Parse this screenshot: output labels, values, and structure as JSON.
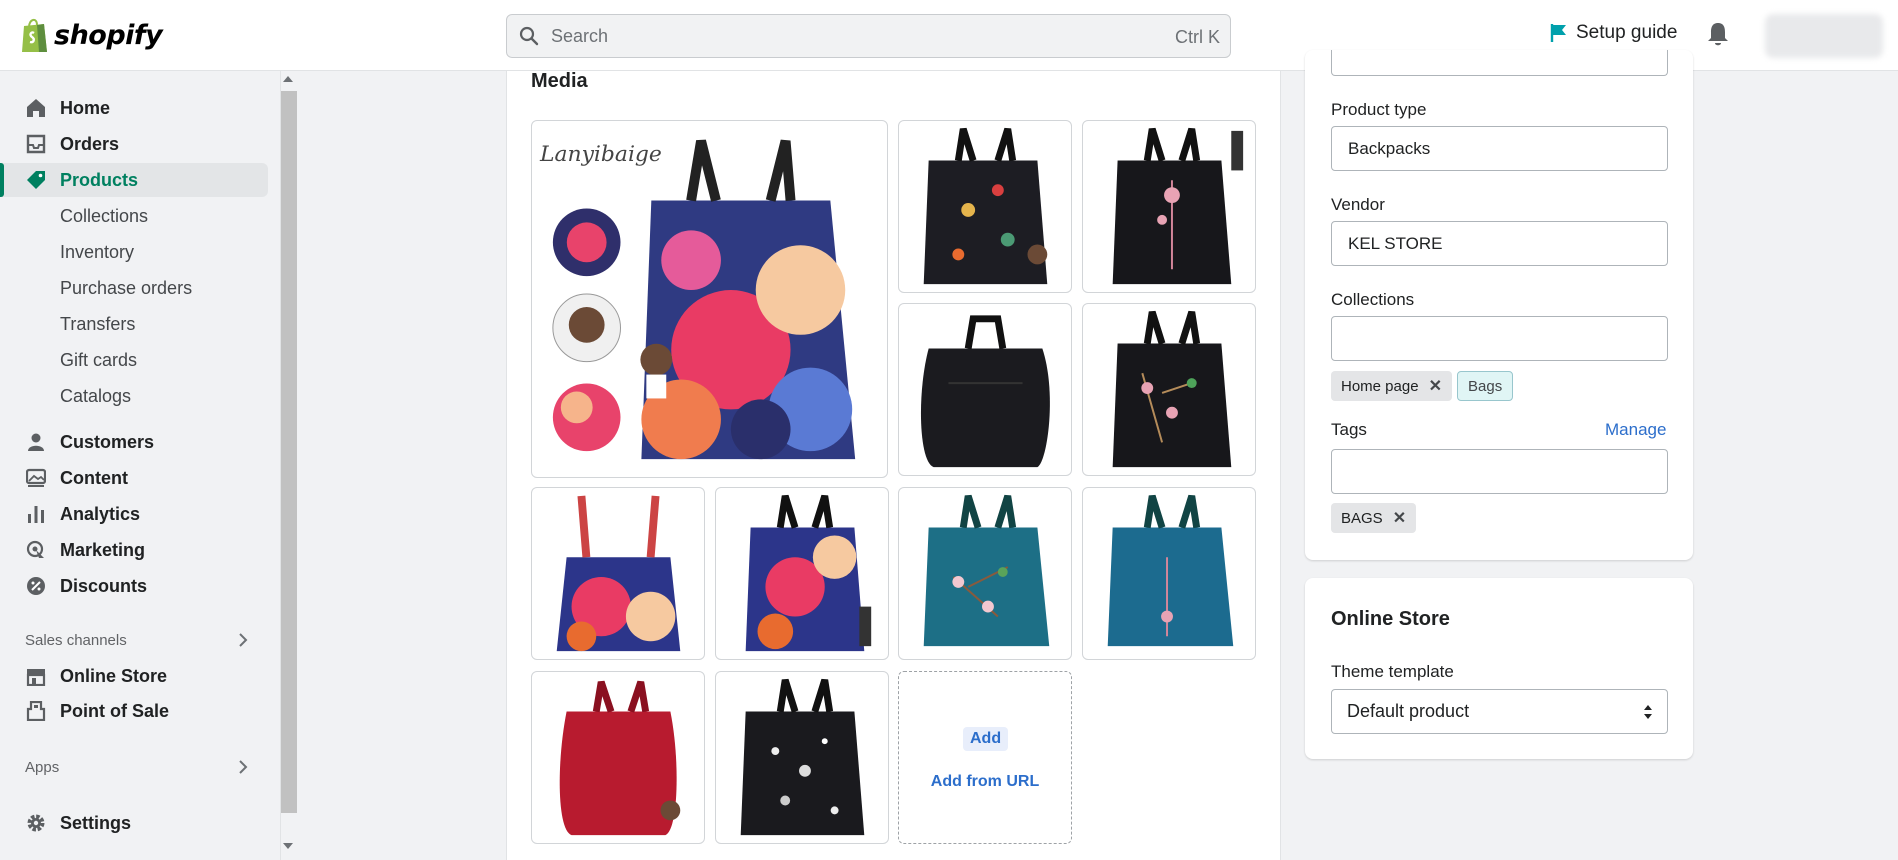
{
  "topbar": {
    "logo_text": "shopify",
    "search_placeholder": "Search",
    "search_shortcut": "Ctrl K",
    "setup_guide": "Setup guide"
  },
  "sidebar": {
    "main": [
      {
        "label": "Home",
        "icon": "home-icon"
      },
      {
        "label": "Orders",
        "icon": "orders-icon"
      },
      {
        "label": "Products",
        "icon": "tag-icon",
        "active": true
      },
      {
        "label": "Collections"
      },
      {
        "label": "Inventory"
      },
      {
        "label": "Purchase orders"
      },
      {
        "label": "Transfers"
      },
      {
        "label": "Gift cards"
      },
      {
        "label": "Catalogs"
      },
      {
        "label": "Customers",
        "icon": "person-icon"
      },
      {
        "label": "Content",
        "icon": "image-icon"
      },
      {
        "label": "Analytics",
        "icon": "bar-chart-icon"
      },
      {
        "label": "Marketing",
        "icon": "target-icon"
      },
      {
        "label": "Discounts",
        "icon": "discount-icon"
      }
    ],
    "sales_channels_heading": "Sales channels",
    "channels": [
      {
        "label": "Online Store",
        "icon": "store-icon"
      },
      {
        "label": "Point of Sale",
        "icon": "pos-icon"
      }
    ],
    "apps_heading": "Apps",
    "settings": "Settings"
  },
  "media": {
    "title": "Media",
    "add_label": "Add",
    "add_from_url_label": "Add from URL",
    "watermark": "Lanyibaige"
  },
  "organization": {
    "product_type_label": "Product type",
    "product_type_value": "Backpacks",
    "vendor_label": "Vendor",
    "vendor_value": "KEL STORE",
    "collections_label": "Collections",
    "collection_chips": [
      "Home page",
      "Bags"
    ],
    "tags_label": "Tags",
    "manage_label": "Manage",
    "tag_chips": [
      "BAGS"
    ]
  },
  "online_store": {
    "title": "Online Store",
    "theme_template_label": "Theme template",
    "theme_template_value": "Default product"
  },
  "colors": {
    "accent_green": "#008060",
    "link_blue": "#2c6ecb",
    "setup_flag": "#00a0ac"
  }
}
